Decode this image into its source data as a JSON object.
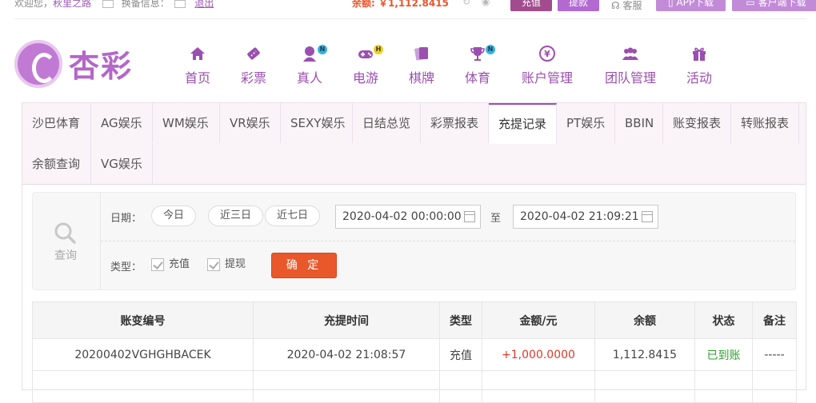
{
  "top": {
    "greeting": "欢迎您，",
    "username": "秋里之路",
    "message_label": "换备信息：",
    "message_link": "退出",
    "balance": "余额: ￥1,112.8415",
    "recharge_label": "充值",
    "withdraw_label": "提款",
    "service_label": "客服",
    "app_label": "APP下载",
    "client_label": "客户端下载"
  },
  "logo": {
    "text": "杏彩"
  },
  "nav": [
    {
      "label": "首页",
      "icon": "home-icon",
      "badge": ""
    },
    {
      "label": "彩票",
      "icon": "ticket-icon",
      "badge": ""
    },
    {
      "label": "真人",
      "icon": "dealer-icon",
      "badge": "N"
    },
    {
      "label": "电游",
      "icon": "gamepad-icon",
      "badge": "H"
    },
    {
      "label": "棋牌",
      "icon": "cards-icon",
      "badge": ""
    },
    {
      "label": "体育",
      "icon": "trophy-icon",
      "badge": "N"
    },
    {
      "label": "账户管理",
      "icon": "yen-icon",
      "badge": ""
    },
    {
      "label": "团队管理",
      "icon": "team-icon",
      "badge": ""
    },
    {
      "label": "活动",
      "icon": "gift-icon",
      "badge": ""
    }
  ],
  "tabs": [
    {
      "label": "沙巴体育"
    },
    {
      "label": "AG娱乐"
    },
    {
      "label": "WM娱乐"
    },
    {
      "label": "VR娱乐"
    },
    {
      "label": "SEXY娱乐"
    },
    {
      "label": "日结总览"
    },
    {
      "label": "彩票报表"
    },
    {
      "label": "充提记录"
    },
    {
      "label": "PT娱乐"
    },
    {
      "label": "BBIN"
    },
    {
      "label": "账变报表"
    },
    {
      "label": "转账报表"
    },
    {
      "label": "余额查询"
    },
    {
      "label": "VG娱乐"
    }
  ],
  "active_tab": "充提记录",
  "filter": {
    "query_label": "查询",
    "date_label": "日期：",
    "quick": [
      "今日",
      "近三日",
      "近七日"
    ],
    "start": "2020-04-02 00:00:00",
    "to": "至",
    "end": "2020-04-02 21:09:21",
    "type_label": "类型：",
    "type_recharge": "充值",
    "type_withdraw": "提现",
    "confirm": "确 定"
  },
  "table": {
    "headers": [
      "账变编号",
      "充提时间",
      "类型",
      "金额/元",
      "余额",
      "状态",
      "备注"
    ],
    "rows": [
      [
        "20200402VGHGHBACEK",
        "2020-04-02 21:08:57",
        "充值",
        "+1,000.0000",
        "1,112.8415",
        "已到账",
        "-----"
      ]
    ]
  },
  "colors": {
    "brand": "#9b4fb0",
    "confirm": "#e8582a",
    "amount": "#e0382a",
    "status_ok": "#2ea12e"
  }
}
